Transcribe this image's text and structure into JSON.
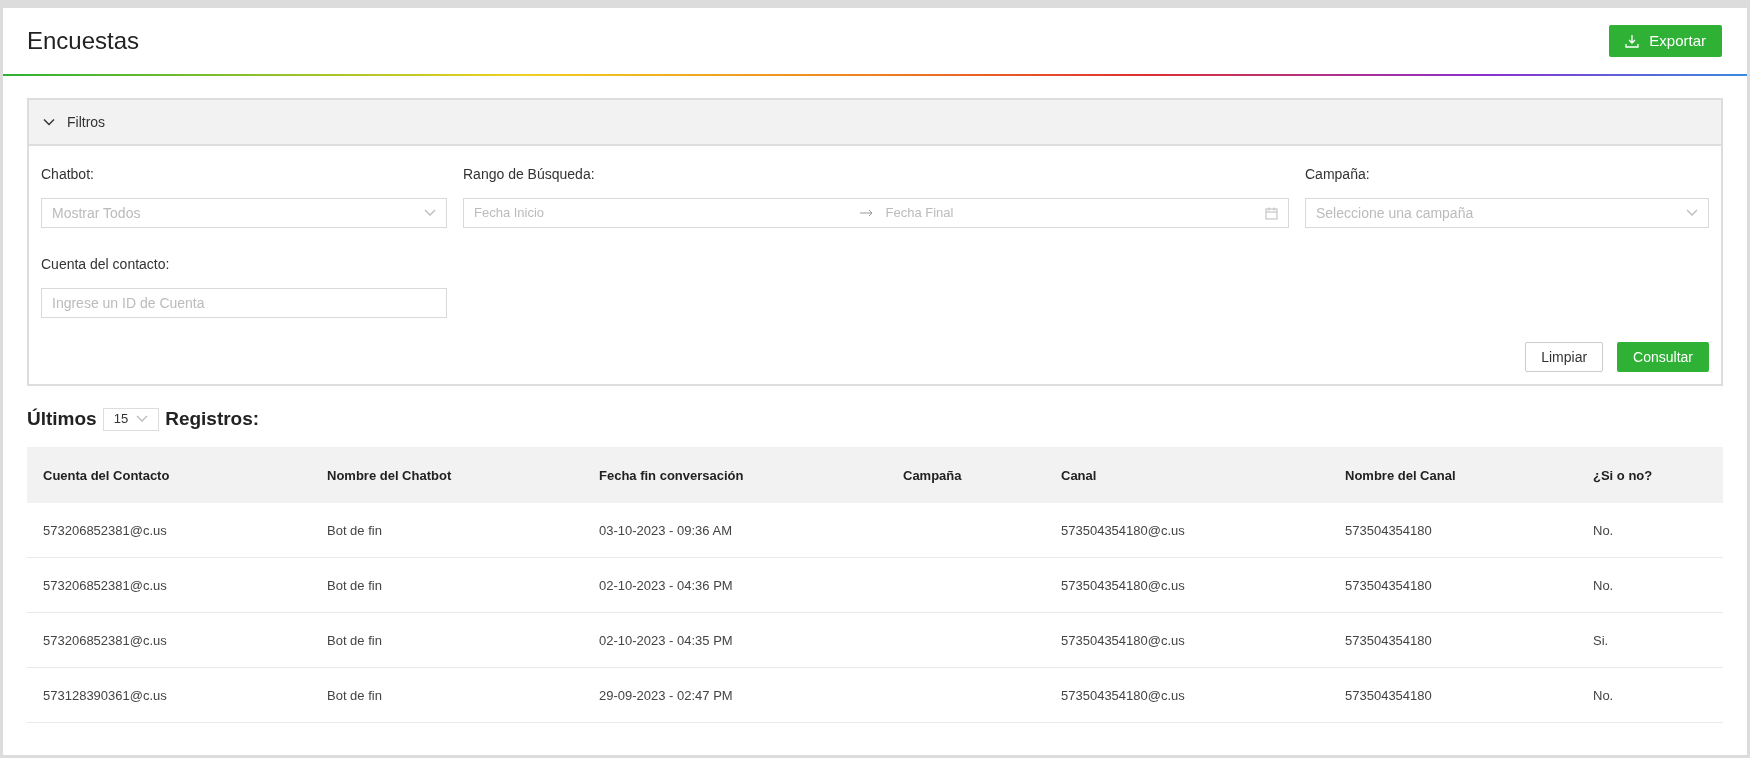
{
  "page": {
    "title": "Encuestas",
    "export_button": "Exportar"
  },
  "filters": {
    "title": "Filtros",
    "expanded": true,
    "chatbot": {
      "label": "Chatbot:",
      "placeholder": "Mostrar Todos"
    },
    "range": {
      "label": "Rango de Búsqueda:",
      "start_placeholder": "Fecha Inicio",
      "end_placeholder": "Fecha Final"
    },
    "campaign": {
      "label": "Campaña:",
      "placeholder": "Seleccione una campaña"
    },
    "account": {
      "label": "Cuenta del contacto:",
      "placeholder": "Ingrese un ID de Cuenta"
    },
    "buttons": {
      "clear": "Limpiar",
      "query": "Consultar"
    }
  },
  "records": {
    "prefix": "Últimos",
    "count": "15",
    "suffix": "Registros:"
  },
  "table": {
    "columns": [
      "Cuenta del Contacto",
      "Nombre del Chatbot",
      "Fecha fin conversación",
      "Campaña",
      "Canal",
      "Nombre del Canal",
      "¿Si o no?"
    ],
    "rows": [
      [
        "573206852381@c.us",
        "Bot de fin",
        "03-10-2023 - 09:36 AM",
        "",
        "573504354180@c.us",
        "573504354180",
        "No."
      ],
      [
        "573206852381@c.us",
        "Bot de fin",
        "02-10-2023 - 04:36 PM",
        "",
        "573504354180@c.us",
        "573504354180",
        "No."
      ],
      [
        "573206852381@c.us",
        "Bot de fin",
        "02-10-2023 - 04:35 PM",
        "",
        "573504354180@c.us",
        "573504354180",
        "Si."
      ],
      [
        "573128390361@c.us",
        "Bot de fin",
        "29-09-2023 - 02:47 PM",
        "",
        "573504354180@c.us",
        "573504354180",
        "No."
      ]
    ]
  }
}
